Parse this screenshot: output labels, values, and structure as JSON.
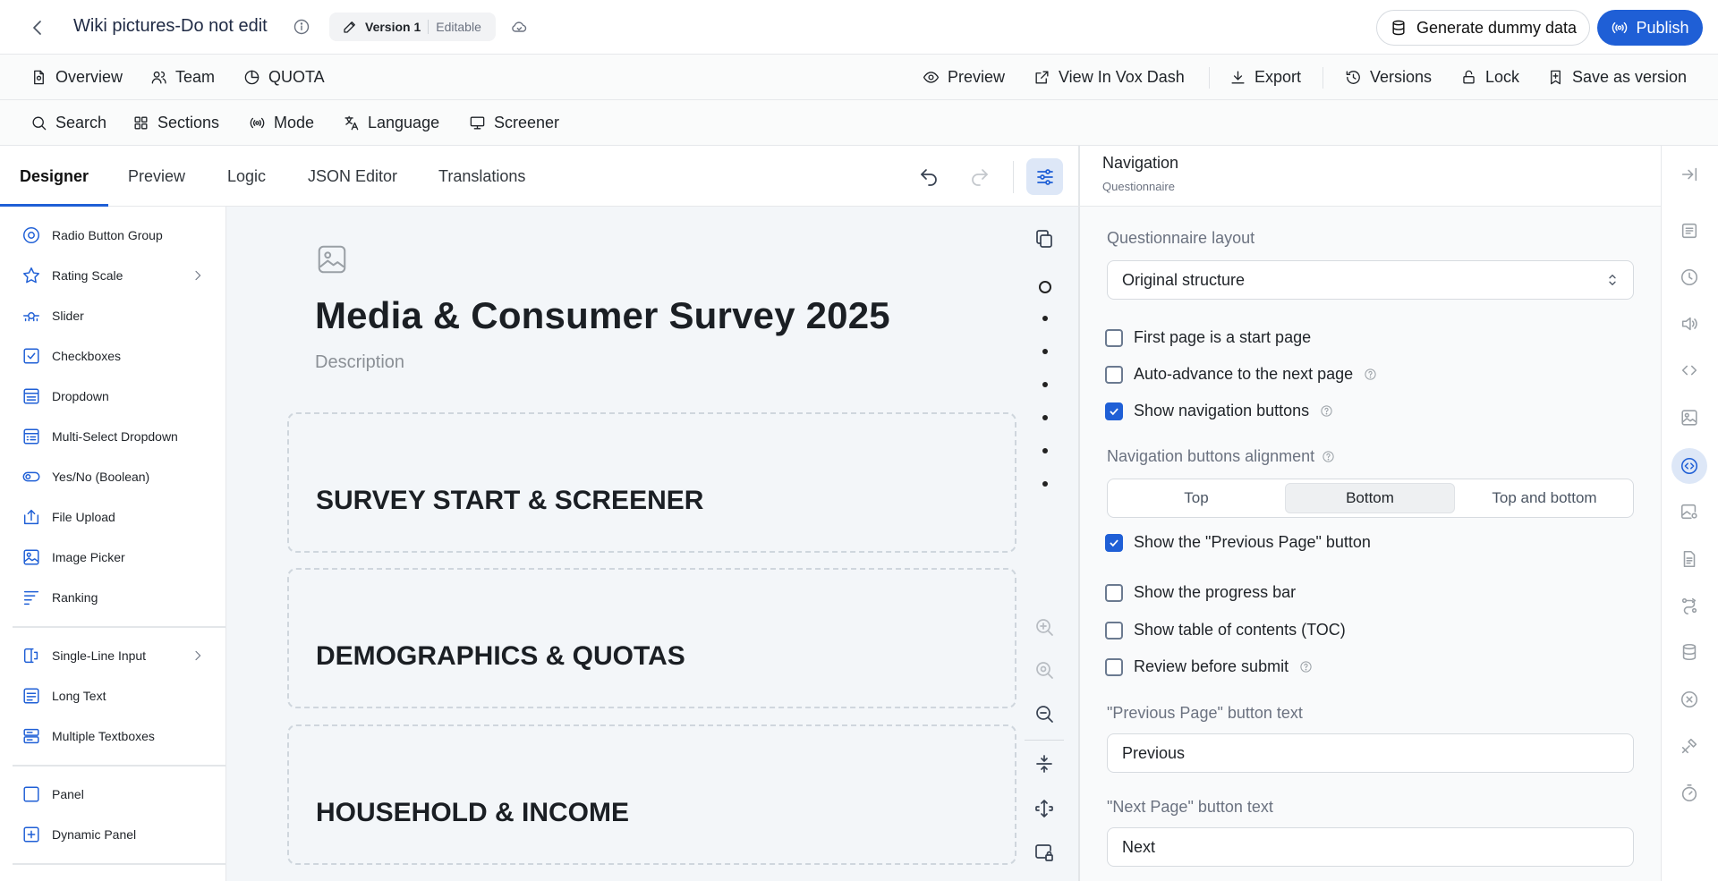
{
  "header": {
    "title": "Wiki pictures-Do not edit",
    "version_label": "Version 1",
    "version_status": "Editable",
    "generate_label": "Generate dummy data",
    "publish_label": "Publish"
  },
  "main_nav": {
    "overview": "Overview",
    "team": "Team",
    "quota": "QUOTA",
    "preview": "Preview",
    "view_in_vox_dash": "View In Vox Dash",
    "export": "Export",
    "versions": "Versions",
    "lock": "Lock",
    "save_as_version": "Save as version"
  },
  "sub_nav": {
    "search": "Search",
    "sections": "Sections",
    "mode": "Mode",
    "language": "Language",
    "screener": "Screener"
  },
  "tabs": [
    {
      "label": "Designer",
      "active": true
    },
    {
      "label": "Preview"
    },
    {
      "label": "Logic"
    },
    {
      "label": "JSON Editor"
    },
    {
      "label": "Translations"
    }
  ],
  "toolbox": [
    {
      "label": "Radio Button Group",
      "icon": "radio-icon"
    },
    {
      "label": "Rating Scale",
      "icon": "star-icon",
      "submenu": true
    },
    {
      "label": "Slider",
      "icon": "slider-icon"
    },
    {
      "label": "Checkboxes",
      "icon": "checkbox-icon"
    },
    {
      "label": "Dropdown",
      "icon": "dropdown-icon"
    },
    {
      "label": "Multi-Select Dropdown",
      "icon": "multiselect-icon"
    },
    {
      "label": "Yes/No (Boolean)",
      "icon": "toggle-icon"
    },
    {
      "label": "File Upload",
      "icon": "upload-icon"
    },
    {
      "label": "Image Picker",
      "icon": "image-picker-icon"
    },
    {
      "label": "Ranking",
      "icon": "ranking-icon"
    },
    {
      "label": "Single-Line Input",
      "icon": "text-cursor-icon",
      "submenu": true
    },
    {
      "label": "Long Text",
      "icon": "long-text-icon"
    },
    {
      "label": "Multiple Textboxes",
      "icon": "multiple-textboxes-icon"
    },
    {
      "label": "Panel",
      "icon": "panel-icon"
    },
    {
      "label": "Dynamic Panel",
      "icon": "dynamic-panel-icon"
    }
  ],
  "survey": {
    "title": "Media & Consumer Survey 2025",
    "description": "Description",
    "sections": [
      "SURVEY START & SCREENER",
      "DEMOGRAPHICS & QUOTAS",
      "HOUSEHOLD & INCOME"
    ]
  },
  "panel": {
    "title": "Navigation",
    "subtitle": "Questionnaire",
    "layout_label": "Questionnaire layout",
    "layout_value": "Original structure",
    "checkboxes_top": [
      {
        "label": "First page is a start page",
        "checked": false,
        "help": false
      },
      {
        "label": "Auto-advance to the next page",
        "checked": false,
        "help": true
      },
      {
        "label": "Show navigation buttons",
        "checked": true,
        "help": true
      }
    ],
    "alignment_label": "Navigation buttons alignment",
    "alignment_options": [
      "Top",
      "Bottom",
      "Top and bottom"
    ],
    "alignment_selected": "Bottom",
    "show_previous": {
      "label": "Show the \"Previous Page\" button",
      "checked": true
    },
    "checkboxes_bottom": [
      {
        "label": "Show the progress bar",
        "checked": false,
        "help": false
      },
      {
        "label": "Show table of contents (TOC)",
        "checked": false,
        "help": false
      },
      {
        "label": "Review before submit",
        "checked": false,
        "help": true
      }
    ],
    "prev_text_label": "\"Previous Page\" button text",
    "prev_text_value": "Previous",
    "next_text_label": "\"Next Page\" button text",
    "next_text_value": "Next"
  },
  "colors": {
    "accent": "#1f5fd6",
    "canvas_bg": "#f3f6f9"
  }
}
